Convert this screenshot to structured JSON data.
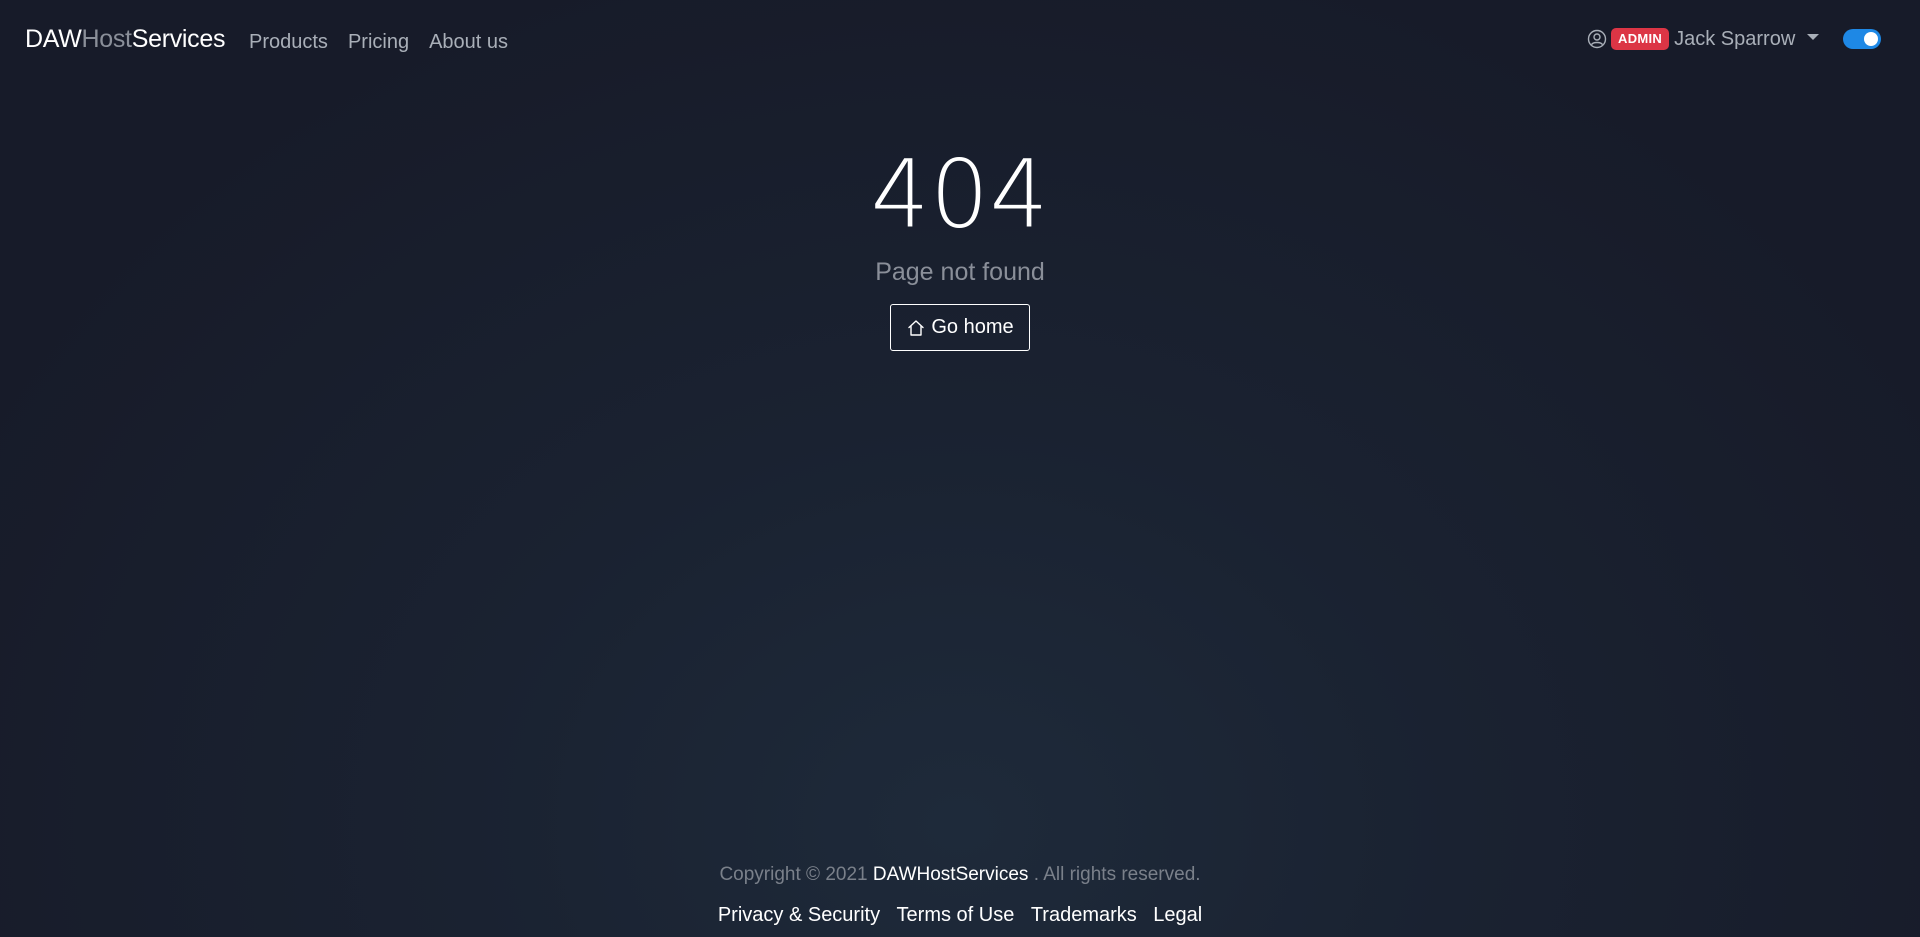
{
  "navbar": {
    "brand": {
      "part1": "DAW",
      "part2": "Host",
      "part3": "Services"
    },
    "links": [
      "Products",
      "Pricing",
      "About us"
    ],
    "user": {
      "icon": "user-circle-icon",
      "role_badge": "ADMIN",
      "name": "Jack Sparrow",
      "caret_icon": "caret-down-icon"
    },
    "theme_toggle": {
      "checked": true
    }
  },
  "main": {
    "error_code": "404",
    "message": "Page not found",
    "home_button": {
      "label": "Go home",
      "icon": "house-icon"
    }
  },
  "footer": {
    "copyright_prefix": "Copyright © 2021",
    "copyright_brand": "DAWHostServices",
    "copyright_suffix": ". All rights reserved.",
    "links": [
      "Privacy & Security",
      "Terms of Use",
      "Trademarks",
      "Legal"
    ]
  },
  "colors": {
    "accent": "#1e88e5",
    "badge": "#dc3545",
    "muted_text": "#8a8f99",
    "background": "#171b29"
  }
}
